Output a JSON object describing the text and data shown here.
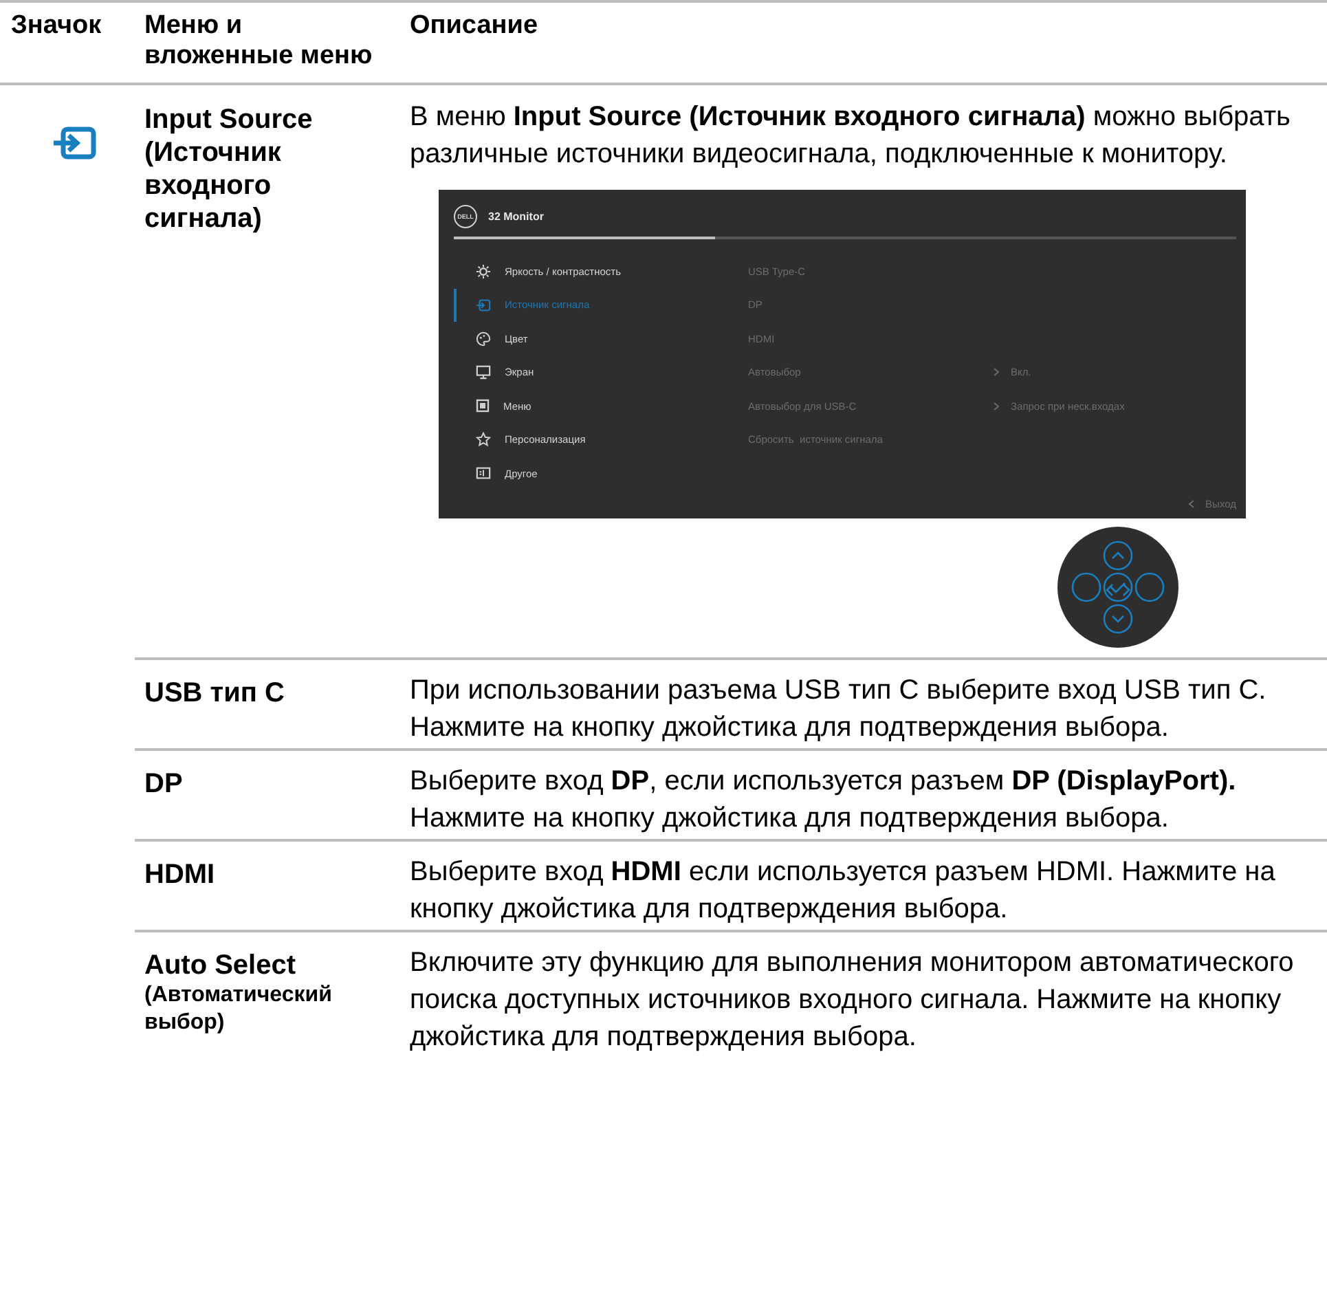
{
  "header": {
    "columns": [
      "Значок",
      "Меню и вложенные меню",
      "Описание"
    ]
  },
  "main_row": {
    "menu": "Input Source (Источник входного сигнала)",
    "description": "В меню **Input Source (Источник входного сигнала)** можно выбрать различные источники видеосигнала, подключенные к монитору.",
    "osd": {
      "logo": "DELL",
      "title": "32 Monitor",
      "exit": "Выход",
      "menu": [
        {
          "label": "Яркость / контрастность",
          "selected": false
        },
        {
          "label": "Источник сигнала",
          "selected": true
        },
        {
          "label": "Цвет",
          "selected": false
        },
        {
          "label": "Экран",
          "selected": false
        },
        {
          "label": "Меню",
          "selected": false
        },
        {
          "label": "Персонализация",
          "selected": false
        },
        {
          "label": "Другое",
          "selected": false
        }
      ],
      "options": [
        {
          "label": "USB Type-C"
        },
        {
          "label": "DP"
        },
        {
          "label": "HDMI"
        },
        {
          "label": "Автовыбор",
          "value": "Вкл."
        },
        {
          "label": "Автовыбор для USB-C",
          "value": "Запрос при неск.входах"
        },
        {
          "label": "Сбросить  источник сигнала"
        }
      ]
    }
  },
  "sub_rows": [
    {
      "name": "USB тип C",
      "description": "При использовании разъема USB тип C выберите вход USB тип C. Нажмите на кнопку джойстика для подтверждения выбора."
    },
    {
      "name": "DP",
      "description": "Выберите вход **DP**, если используется разъем **DP (DisplayPort).** Нажмите на кнопку джойстика для подтверждения выбора."
    },
    {
      "name": "HDMI",
      "description": "Выберите вход **HDMI** если используется разъем HDMI. Нажмите на кнопку джойстика для подтверждения выбора."
    },
    {
      "name": "Auto Select",
      "note": "(Автоматический выбор)",
      "description": "Включите эту функцию для выполнения монитором автоматического поиска доступных источников входного сигнала. Нажмите на кнопку джойстика для подтверждения выбора."
    }
  ]
}
